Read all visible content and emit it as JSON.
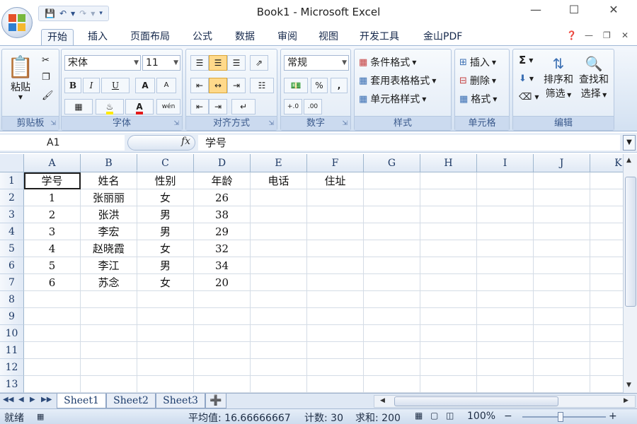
{
  "window": {
    "title": "Book1 - Microsoft Excel"
  },
  "qat": {
    "save_icon": "save-icon",
    "undo_icon": "undo-icon",
    "redo_icon": "redo-icon"
  },
  "tabs": [
    {
      "label": "开始",
      "active": true
    },
    {
      "label": "插入"
    },
    {
      "label": "页面布局"
    },
    {
      "label": "公式"
    },
    {
      "label": "数据"
    },
    {
      "label": "审阅"
    },
    {
      "label": "视图"
    },
    {
      "label": "开发工具"
    },
    {
      "label": "金山PDF"
    }
  ],
  "ribbon": {
    "clipboard": {
      "paste": "粘贴",
      "label": "剪贴板"
    },
    "font": {
      "name": "宋体",
      "size": "11",
      "bold": "B",
      "italic": "I",
      "underline": "U",
      "grow": "A",
      "shrink": "A",
      "font_color": "A",
      "phonetic": "wén",
      "label": "字体"
    },
    "align": {
      "label": "对齐方式"
    },
    "number": {
      "format": "常规",
      "percent": "%",
      "comma": ",",
      "label": "数字"
    },
    "styles": {
      "conditional": "条件格式",
      "table": "套用表格格式",
      "cell": "单元格样式",
      "label": "样式"
    },
    "cells": {
      "insert": "插入",
      "delete": "删除",
      "format": "格式",
      "label": "单元格"
    },
    "editing": {
      "sum": "Σ",
      "sort_1": "排序和",
      "sort_2": "筛选",
      "find_1": "查找和",
      "find_2": "选择",
      "label": "编辑"
    }
  },
  "formula_bar": {
    "name_box": "A1",
    "fx": "fx",
    "value": "学号"
  },
  "grid": {
    "columns": [
      "A",
      "B",
      "C",
      "D",
      "E",
      "F",
      "G",
      "H",
      "I",
      "J",
      "K"
    ],
    "rows": [
      "1",
      "2",
      "3",
      "4",
      "5",
      "6",
      "7",
      "8",
      "9",
      "10",
      "11",
      "12",
      "13"
    ],
    "cells": [
      [
        "学号",
        "姓名",
        "性别",
        "年龄",
        "电话",
        "住址"
      ],
      [
        "1",
        "张丽丽",
        "女",
        "26"
      ],
      [
        "2",
        "张洪",
        "男",
        "38"
      ],
      [
        "3",
        "李宏",
        "男",
        "29"
      ],
      [
        "4",
        "赵晓霞",
        "女",
        "32"
      ],
      [
        "5",
        "李江",
        "男",
        "34"
      ],
      [
        "6",
        "苏念",
        "女",
        "20"
      ]
    ]
  },
  "sheets": [
    "Sheet1",
    "Sheet2",
    "Sheet3"
  ],
  "status": {
    "ready": "就绪",
    "average": "平均值: 16.66666667",
    "count": "计数: 30",
    "sum": "求和: 200",
    "zoom": "100%",
    "zoom_out": "−",
    "zoom_in": "+"
  }
}
